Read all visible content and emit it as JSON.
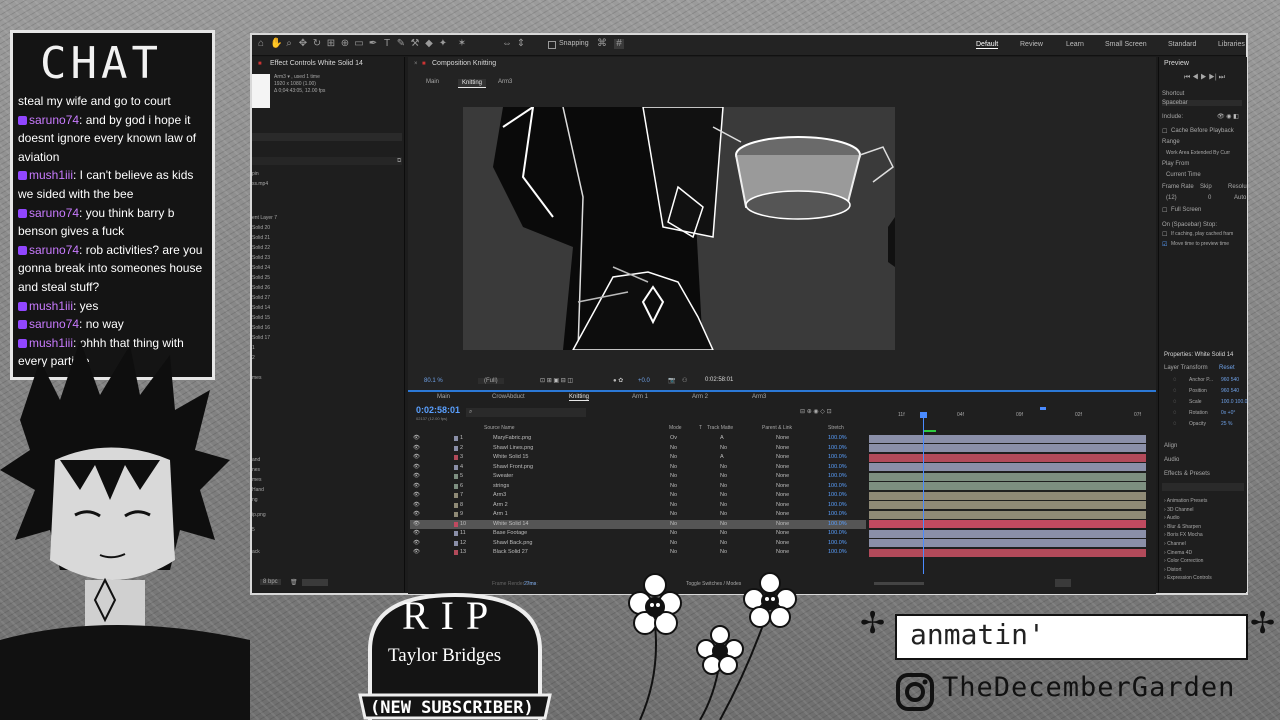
{
  "chat": {
    "title": "CHAT",
    "messages": [
      {
        "user": "",
        "text": "steal my wife and go to court"
      },
      {
        "user": "saruno74",
        "text": ": and by god i hope it doesnt ignore every known law of aviation"
      },
      {
        "user": "mush1iii",
        "text": ": I can't believe as kids we sided with the bee"
      },
      {
        "user": "saruno74",
        "text": ": you think barry b benson gives a fuck"
      },
      {
        "user": "saruno74",
        "text": ": rob activities? are you gonna break into someones house and steal stuff?"
      },
      {
        "user": "mush1iii",
        "text": ": yes"
      },
      {
        "user": "saruno74",
        "text": ": no way"
      },
      {
        "user": "mush1iii",
        "text": ": ohhh that thing with every particle"
      }
    ]
  },
  "toolbar": {
    "snapping_label": "Snapping",
    "workspaces": [
      "Default",
      "Review",
      "Learn",
      "Small Screen",
      "Standard",
      "Libraries"
    ]
  },
  "effect_controls": {
    "title": "Effect Controls White Solid 14",
    "info_lines": [
      "Arm3 ▾ , used 1 time",
      "1920 x 1080 (1.00)",
      "Δ 0;04:43:05, 12.00 fps"
    ],
    "project_items": [
      "pin",
      "ss.mp4",
      "ent Layer 7",
      "Solid 20",
      "Solid 21",
      "Solid 22",
      "Solid 23",
      "Solid 24",
      "Solid 25",
      "Solid 26",
      "Solid 27",
      "Solid 14",
      "Solid 15",
      "Solid 16",
      "Solid 17",
      "1",
      "2",
      "mes",
      "and",
      "nes",
      "mes",
      "Hand",
      "ng",
      "ip.png",
      "5",
      "ack"
    ],
    "bpc": "8 bpc"
  },
  "composition": {
    "panel_title": "Composition Knitting",
    "tabs": [
      "Main",
      "Knitting",
      "Arm3"
    ],
    "zoom": "80.1 %",
    "resolution": "(Full)",
    "timecode": "0:02:58:01",
    "exposure": "+0.0"
  },
  "timeline": {
    "tabs": [
      "Main",
      "CrowAbduct",
      "Knitting",
      "Arm 1",
      "Arm 2",
      "Arm3"
    ],
    "timecode": "0:02:58:01",
    "frame_info": "02137 (12.00 fps)",
    "columns": [
      "Source Name",
      "Mode",
      "T",
      "Track Matte",
      "Parent & Link",
      "Stretch"
    ],
    "ruler": [
      "11f",
      "04f",
      "09f",
      "02f",
      "07f"
    ],
    "layers": [
      {
        "num": "1",
        "name": "MaryFabric.png",
        "mode": "Ov",
        "matte": "A",
        "parent": "None",
        "stretch": "100.0%",
        "color": "#8a8fa8"
      },
      {
        "num": "2",
        "name": "Shawl Lines.png",
        "mode": "No",
        "matte": "No",
        "parent": "None",
        "stretch": "100.0%",
        "color": "#8a8fa8"
      },
      {
        "num": "3",
        "name": "White Solid 15",
        "mode": "No",
        "matte": "A",
        "parent": "None",
        "stretch": "100.0%",
        "color": "#b24a5a"
      },
      {
        "num": "4",
        "name": "Shawl Front.png",
        "mode": "No",
        "matte": "No",
        "parent": "None",
        "stretch": "100.0%",
        "color": "#8a8fa8"
      },
      {
        "num": "5",
        "name": "Sweater",
        "mode": "No",
        "matte": "No",
        "parent": "None",
        "stretch": "100.0%",
        "color": "#7d8f80"
      },
      {
        "num": "6",
        "name": "strings",
        "mode": "No",
        "matte": "No",
        "parent": "None",
        "stretch": "100.0%",
        "color": "#7d8f80"
      },
      {
        "num": "7",
        "name": "Arm3",
        "mode": "No",
        "matte": "No",
        "parent": "None",
        "stretch": "100.0%",
        "color": "#8f8a76"
      },
      {
        "num": "8",
        "name": "Arm 2",
        "mode": "No",
        "matte": "No",
        "parent": "None",
        "stretch": "100.0%",
        "color": "#8f8a76"
      },
      {
        "num": "9",
        "name": "Arm 1",
        "mode": "No",
        "matte": "No",
        "parent": "None",
        "stretch": "100.0%",
        "color": "#8f8a76"
      },
      {
        "num": "10",
        "name": "White Solid 14",
        "mode": "No",
        "matte": "No",
        "parent": "None",
        "stretch": "100.0%",
        "color": "#c04a60"
      },
      {
        "num": "11",
        "name": "Base Footage",
        "mode": "No",
        "matte": "No",
        "parent": "None",
        "stretch": "100.0%",
        "color": "#8a8fa8"
      },
      {
        "num": "12",
        "name": "Shawl Back.png",
        "mode": "No",
        "matte": "No",
        "parent": "None",
        "stretch": "100.0%",
        "color": "#8a8fa8"
      },
      {
        "num": "13",
        "name": "Black Solid 27",
        "mode": "No",
        "matte": "No",
        "parent": "None",
        "stretch": "100.0%",
        "color": "#b24a5a"
      }
    ],
    "render_time_label": "Frame Render Time:",
    "render_time": "27ms",
    "toggle_label": "Toggle Switches / Modes"
  },
  "preview": {
    "title": "Preview",
    "shortcut_label": "Shortcut",
    "shortcut": "Spacebar",
    "include_label": "Include:",
    "cache_label": "Cache Before Playback",
    "range_label": "Range",
    "range": "Work Area Extended By Curr",
    "play_from_label": "Play From",
    "play_from": "Current Time",
    "frame_rate_label": "Frame Rate",
    "skip_label": "Skip",
    "resolution_label": "Resolu",
    "frame_rate": "(12)",
    "skip": "0",
    "resolution": "Auto",
    "full_screen_label": "Full Screen",
    "on_stop_label": "On (Spacebar) Stop:",
    "if_caching_label": "If caching, play cached fram",
    "move_time_label": "Move time to preview time"
  },
  "properties": {
    "title": "Properties: White Solid 14",
    "transform_label": "Layer Transform",
    "reset": "Reset",
    "items": [
      {
        "label": "Anchor P...",
        "value": "960  540"
      },
      {
        "label": "Position",
        "value": "960  540"
      },
      {
        "label": "Scale",
        "value": "100.0  100.0"
      },
      {
        "label": "Rotation",
        "value": "0x +0°"
      },
      {
        "label": "Opacity",
        "value": "25 %"
      }
    ],
    "sections": [
      "Align",
      "Audio",
      "Effects & Presets"
    ],
    "effects": [
      "Animation Presets",
      "3D Channel",
      "Audio",
      "Blur & Sharpen",
      "Boris FX Mocha",
      "Channel",
      "Cinema 4D",
      "Color Correction",
      "Distort",
      "Expression Controls"
    ]
  },
  "overlays": {
    "rip": "RIP",
    "rip_name": "Taylor Bridges",
    "rip_sub": "(NEW SUBSCRIBER)",
    "status": "anmatin'",
    "instagram": "TheDecemberGarden"
  },
  "colors": {
    "ae_blue": "#2b78d6",
    "twitch_purple": "#9146ff",
    "username": "#c97bff",
    "playhead": "#4a8bff"
  }
}
